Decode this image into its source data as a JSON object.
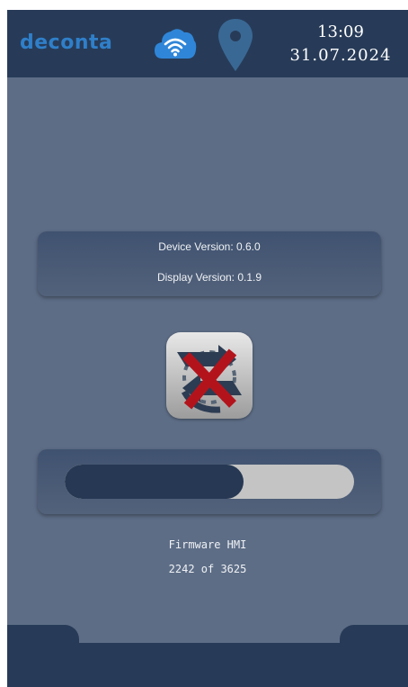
{
  "header": {
    "logo_text": "deconta",
    "cloud_icon": "cloud-wifi-icon",
    "location_icon": "location-pin-icon",
    "time": "13:09",
    "date": "31.07.2024"
  },
  "versions": {
    "device_version": "Device Version: 0.6.0",
    "display_version": "Display Version: 0.1.9"
  },
  "update_status_icon": "update-failed-icon",
  "progress": {
    "fraction": 0.618,
    "firmware_label": "Firmware HMI",
    "count_label": "2242 of 3625"
  },
  "colors": {
    "header_bg": "#273b58",
    "screen_bg": "#5d6d86",
    "brand_blue": "#2f7fc9",
    "error_red": "#b3141c"
  }
}
